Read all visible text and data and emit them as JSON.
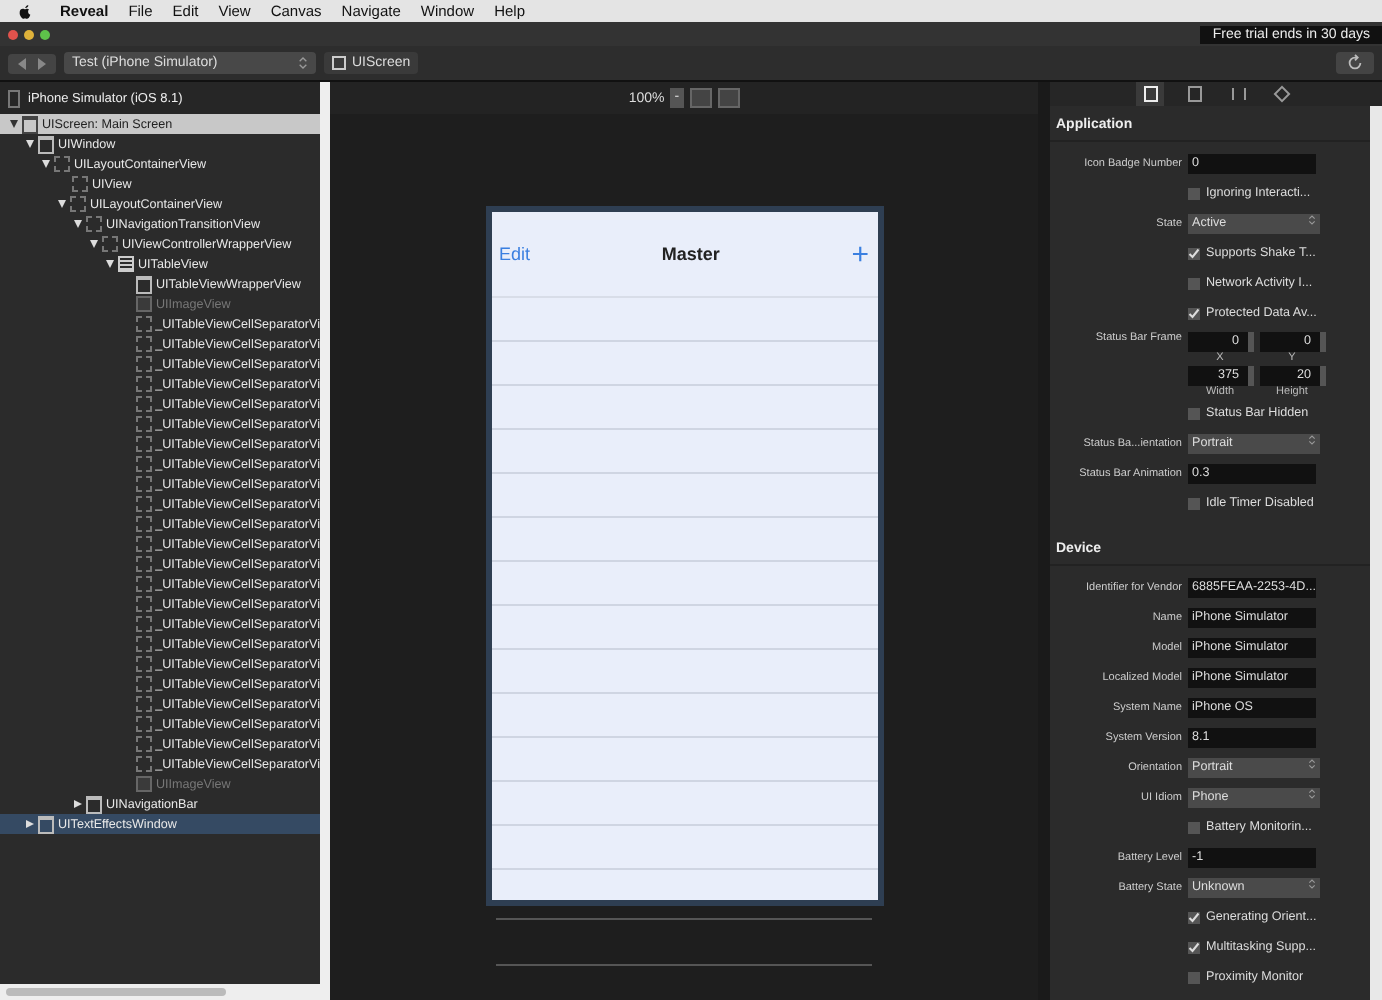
{
  "menu_bar": {
    "app": "Reveal",
    "items": [
      "File",
      "Edit",
      "View",
      "Canvas",
      "Navigate",
      "Window",
      "Help"
    ]
  },
  "title_bar": {
    "trial_badge": "Free trial ends in 30 days"
  },
  "toolbar": {
    "target": "Test (iPhone Simulator)",
    "breadcrumb": "UIScreen"
  },
  "sidebar": {
    "header": "iPhone Simulator (iOS 8.1)",
    "tree": [
      {
        "label": "UIScreen: Main Screen",
        "kind": "screen",
        "selected": false,
        "dimmed": false,
        "expanded": true,
        "children": [
          {
            "label": "UIWindow",
            "kind": "window",
            "selected": false,
            "dimmed": false,
            "expanded": true,
            "children": [
              {
                "label": "UILayoutContainerView",
                "kind": "view",
                "selected": false,
                "dimmed": false,
                "expanded": true,
                "children": [
                  {
                    "label": "UIView",
                    "kind": "view",
                    "selected": false,
                    "dimmed": false
                  },
                  {
                    "label": "UILayoutContainerView",
                    "kind": "view",
                    "selected": false,
                    "dimmed": false,
                    "expanded": true,
                    "children": [
                      {
                        "label": "UINavigationTransitionView",
                        "kind": "view",
                        "selected": false,
                        "dimmed": false,
                        "expanded": true,
                        "children": [
                          {
                            "label": "UIViewControllerWrapperView",
                            "kind": "view",
                            "selected": false,
                            "dimmed": false,
                            "expanded": true,
                            "children": [
                              {
                                "label": "UITableView",
                                "kind": "table",
                                "selected": false,
                                "dimmed": false,
                                "expanded": true,
                                "children": [
                                  {
                                    "label": "UITableViewWrapperView",
                                    "kind": "window",
                                    "selected": false,
                                    "dimmed": false
                                  },
                                  {
                                    "label": "UIImageView",
                                    "kind": "image",
                                    "selected": false,
                                    "dimmed": true
                                  },
                                  {
                                    "label": "_UITableViewCellSeparatorVi",
                                    "kind": "view",
                                    "selected": false,
                                    "dimmed": false
                                  },
                                  {
                                    "label": "_UITableViewCellSeparatorVi",
                                    "kind": "view",
                                    "selected": false,
                                    "dimmed": false
                                  },
                                  {
                                    "label": "_UITableViewCellSeparatorVi",
                                    "kind": "view",
                                    "selected": false,
                                    "dimmed": false
                                  },
                                  {
                                    "label": "_UITableViewCellSeparatorVi",
                                    "kind": "view",
                                    "selected": false,
                                    "dimmed": false
                                  },
                                  {
                                    "label": "_UITableViewCellSeparatorVi",
                                    "kind": "view",
                                    "selected": false,
                                    "dimmed": false
                                  },
                                  {
                                    "label": "_UITableViewCellSeparatorVi",
                                    "kind": "view",
                                    "selected": false,
                                    "dimmed": false
                                  },
                                  {
                                    "label": "_UITableViewCellSeparatorVi",
                                    "kind": "view",
                                    "selected": false,
                                    "dimmed": false
                                  },
                                  {
                                    "label": "_UITableViewCellSeparatorVi",
                                    "kind": "view",
                                    "selected": false,
                                    "dimmed": false
                                  },
                                  {
                                    "label": "_UITableViewCellSeparatorVi",
                                    "kind": "view",
                                    "selected": false,
                                    "dimmed": false
                                  },
                                  {
                                    "label": "_UITableViewCellSeparatorVi",
                                    "kind": "view",
                                    "selected": false,
                                    "dimmed": false
                                  },
                                  {
                                    "label": "_UITableViewCellSeparatorVi",
                                    "kind": "view",
                                    "selected": false,
                                    "dimmed": false
                                  },
                                  {
                                    "label": "_UITableViewCellSeparatorVi",
                                    "kind": "view",
                                    "selected": false,
                                    "dimmed": false
                                  },
                                  {
                                    "label": "_UITableViewCellSeparatorVi",
                                    "kind": "view",
                                    "selected": false,
                                    "dimmed": false
                                  },
                                  {
                                    "label": "_UITableViewCellSeparatorVi",
                                    "kind": "view",
                                    "selected": false,
                                    "dimmed": false
                                  },
                                  {
                                    "label": "_UITableViewCellSeparatorVi",
                                    "kind": "view",
                                    "selected": false,
                                    "dimmed": false
                                  },
                                  {
                                    "label": "_UITableViewCellSeparatorVi",
                                    "kind": "view",
                                    "selected": false,
                                    "dimmed": false
                                  },
                                  {
                                    "label": "_UITableViewCellSeparatorVi",
                                    "kind": "view",
                                    "selected": false,
                                    "dimmed": false
                                  },
                                  {
                                    "label": "_UITableViewCellSeparatorVi",
                                    "kind": "view",
                                    "selected": false,
                                    "dimmed": false
                                  },
                                  {
                                    "label": "_UITableViewCellSeparatorVi",
                                    "kind": "view",
                                    "selected": false,
                                    "dimmed": false
                                  },
                                  {
                                    "label": "_UITableViewCellSeparatorVi",
                                    "kind": "view",
                                    "selected": false,
                                    "dimmed": false
                                  },
                                  {
                                    "label": "_UITableViewCellSeparatorVi",
                                    "kind": "view",
                                    "selected": false,
                                    "dimmed": false
                                  },
                                  {
                                    "label": "_UITableViewCellSeparatorVi",
                                    "kind": "view",
                                    "selected": false,
                                    "dimmed": false
                                  },
                                  {
                                    "label": "_UITableViewCellSeparatorVi",
                                    "kind": "view",
                                    "selected": false,
                                    "dimmed": false
                                  },
                                  {
                                    "label": "UIImageView",
                                    "kind": "image",
                                    "selected": false,
                                    "dimmed": true
                                  }
                                ]
                              }
                            ]
                          }
                        ]
                      },
                      {
                        "label": "UINavigationBar",
                        "kind": "window",
                        "selected": false,
                        "dimmed": false,
                        "expanded": false
                      }
                    ]
                  }
                ]
              }
            ]
          },
          {
            "label": "UITextEffectsWindow",
            "kind": "window",
            "selected": true,
            "dimmed": false,
            "expanded": false
          }
        ]
      }
    ]
  },
  "canvas": {
    "zoom": "100%",
    "zoom_button": "-",
    "screen": {
      "left_button": "Edit",
      "title": "Master",
      "right_button": "+"
    }
  },
  "inspector": {
    "tabs": [
      {
        "kind": "file",
        "selected": true
      },
      {
        "kind": "size",
        "selected": false
      },
      {
        "kind": "sliders",
        "selected": false
      },
      {
        "kind": "layers",
        "selected": false
      }
    ],
    "sections": [
      {
        "title": "Application",
        "rows": [
          {
            "kind": "text",
            "label": "Icon Badge Number",
            "value": "0"
          },
          {
            "kind": "check",
            "label": "Ignoring Interacti...",
            "checked": false
          },
          {
            "kind": "select",
            "label": "State",
            "value": "Active"
          },
          {
            "kind": "check",
            "label": "Supports Shake T...",
            "checked": true
          },
          {
            "kind": "check",
            "label": "Network Activity I...",
            "checked": false
          },
          {
            "kind": "check",
            "label": "Protected Data Av...",
            "checked": true
          },
          {
            "kind": "frame",
            "label": "Status Bar Frame",
            "fields": [
              {
                "value": "0",
                "label": "X"
              },
              {
                "value": "0",
                "label": "Y"
              },
              {
                "value": "375",
                "label": "Width"
              },
              {
                "value": "20",
                "label": "Height"
              }
            ]
          },
          {
            "kind": "check",
            "label": "Status Bar Hidden",
            "checked": false
          },
          {
            "kind": "select",
            "label": "Status Ba...ientation",
            "value": "Portrait"
          },
          {
            "kind": "text",
            "label": "Status Bar Animation",
            "value": "0.3"
          },
          {
            "kind": "check",
            "label": "Idle Timer Disabled",
            "checked": false
          }
        ]
      },
      {
        "title": "Device",
        "rows": [
          {
            "kind": "text",
            "label": "Identifier for Vendor",
            "value": "6885FEAA-2253-4D..."
          },
          {
            "kind": "text",
            "label": "Name",
            "value": "iPhone Simulator"
          },
          {
            "kind": "text",
            "label": "Model",
            "value": "iPhone Simulator"
          },
          {
            "kind": "text",
            "label": "Localized Model",
            "value": "iPhone Simulator"
          },
          {
            "kind": "text",
            "label": "System Name",
            "value": "iPhone OS"
          },
          {
            "kind": "text",
            "label": "System Version",
            "value": "8.1"
          },
          {
            "kind": "select",
            "label": "Orientation",
            "value": "Portrait"
          },
          {
            "kind": "select",
            "label": "UI Idiom",
            "value": "Phone"
          },
          {
            "kind": "check",
            "label": "Battery Monitorin...",
            "checked": false
          },
          {
            "kind": "text",
            "label": "Battery Level",
            "value": "-1"
          },
          {
            "kind": "select",
            "label": "Battery State",
            "value": "Unknown"
          },
          {
            "kind": "check",
            "label": "Generating Orient...",
            "checked": true
          },
          {
            "kind": "check",
            "label": "Multitasking Supp...",
            "checked": true
          },
          {
            "kind": "check",
            "label": "Proximity Monitor",
            "checked": false
          }
        ]
      }
    ]
  }
}
